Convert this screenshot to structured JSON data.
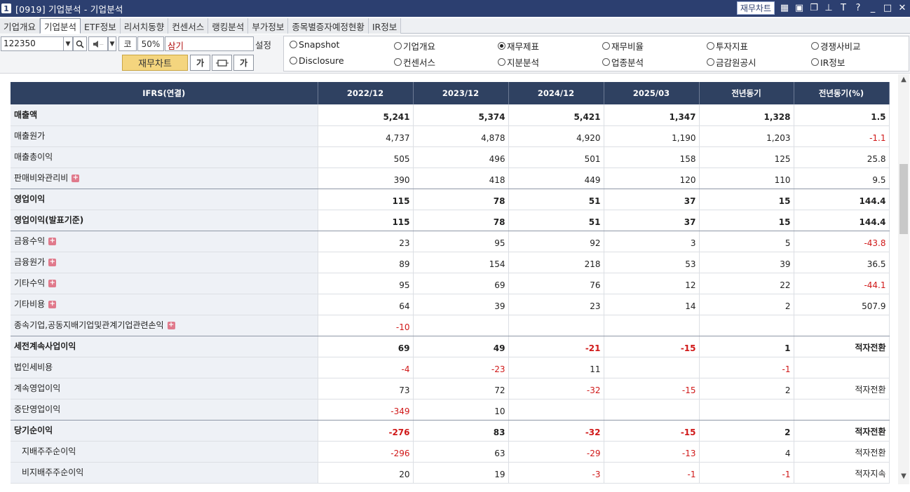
{
  "window": {
    "num": "1",
    "title": "[0919] 기업분석 - 기업분석",
    "chart_button": "재무차트",
    "icons": [
      "chart-icon",
      "window-icon",
      "copy-icon",
      "pin-icon",
      "font-icon",
      "help-icon",
      "minimize-icon",
      "maximize-icon",
      "close-icon"
    ]
  },
  "tabs": [
    "기업개요",
    "기업분석",
    "ETF정보",
    "리서치동향",
    "컨센서스",
    "랭킹분석",
    "부가정보",
    "종목별증자예정현황",
    "IR정보"
  ],
  "active_tab": "기업분석",
  "toolbar": {
    "code": "122350",
    "ko_label": "코",
    "percent": "50%",
    "name": "삼기",
    "settings": "설정",
    "fin_chart": "재무차트",
    "font_btn": "가",
    "font_btn2": "가"
  },
  "radios": {
    "row1": [
      "Snapshot",
      "기업개요",
      "재무제표",
      "재무비율",
      "투자지표",
      "경쟁사비교"
    ],
    "row2": [
      "Disclosure",
      "컨센서스",
      "지분분석",
      "업종분석",
      "금감원공시",
      "IR정보"
    ],
    "selected": "재무제표"
  },
  "table": {
    "headers": [
      "IFRS(연결)",
      "2022/12",
      "2023/12",
      "2024/12",
      "2025/03",
      "전년동기",
      "전년동기(%)"
    ],
    "rows": [
      {
        "label": "매출액",
        "values": [
          "5,241",
          "5,374",
          "5,421",
          "1,347",
          "1,328",
          "1.5"
        ]
      },
      {
        "label": "매출원가",
        "values": [
          "4,737",
          "4,878",
          "4,920",
          "1,190",
          "1,203",
          "-1.1"
        ]
      },
      {
        "label": "매출총이익",
        "values": [
          "505",
          "496",
          "501",
          "158",
          "125",
          "25.8"
        ]
      },
      {
        "label": "판매비와관리비",
        "values": [
          "390",
          "418",
          "449",
          "120",
          "110",
          "9.5"
        ]
      },
      {
        "label": "영업이익",
        "values": [
          "115",
          "78",
          "51",
          "37",
          "15",
          "144.4"
        ]
      },
      {
        "label": "영업이익(발표기준)",
        "values": [
          "115",
          "78",
          "51",
          "37",
          "15",
          "144.4"
        ]
      },
      {
        "label": "금융수익",
        "values": [
          "23",
          "95",
          "92",
          "3",
          "5",
          "-43.8"
        ]
      },
      {
        "label": "금융원가",
        "values": [
          "89",
          "154",
          "218",
          "53",
          "39",
          "36.5"
        ]
      },
      {
        "label": "기타수익",
        "values": [
          "95",
          "69",
          "76",
          "12",
          "22",
          "-44.1"
        ]
      },
      {
        "label": "기타비용",
        "values": [
          "64",
          "39",
          "23",
          "14",
          "2",
          "507.9"
        ]
      },
      {
        "label": "종속기업,공동지배기업및관계기업관련손익",
        "values": [
          "-10",
          "",
          "",
          "",
          "",
          ""
        ]
      },
      {
        "label": "세전계속사업이익",
        "values": [
          "69",
          "49",
          "-21",
          "-15",
          "1",
          "적자전환"
        ]
      },
      {
        "label": "법인세비용",
        "values": [
          "-4",
          "-23",
          "11",
          "",
          "-1",
          ""
        ]
      },
      {
        "label": "계속영업이익",
        "values": [
          "73",
          "72",
          "-32",
          "-15",
          "2",
          "적자전환"
        ]
      },
      {
        "label": "중단영업이익",
        "values": [
          "-349",
          "10",
          "",
          "",
          "",
          ""
        ]
      },
      {
        "label": "당기순이익",
        "values": [
          "-276",
          "83",
          "-32",
          "-15",
          "2",
          "적자전환"
        ]
      },
      {
        "label": "지배주주순이익",
        "values": [
          "-296",
          "63",
          "-29",
          "-13",
          "4",
          "적자전환"
        ]
      },
      {
        "label": "비지배주주순이익",
        "values": [
          "20",
          "19",
          "-3",
          "-1",
          "-1",
          "적자지속"
        ]
      }
    ]
  }
}
